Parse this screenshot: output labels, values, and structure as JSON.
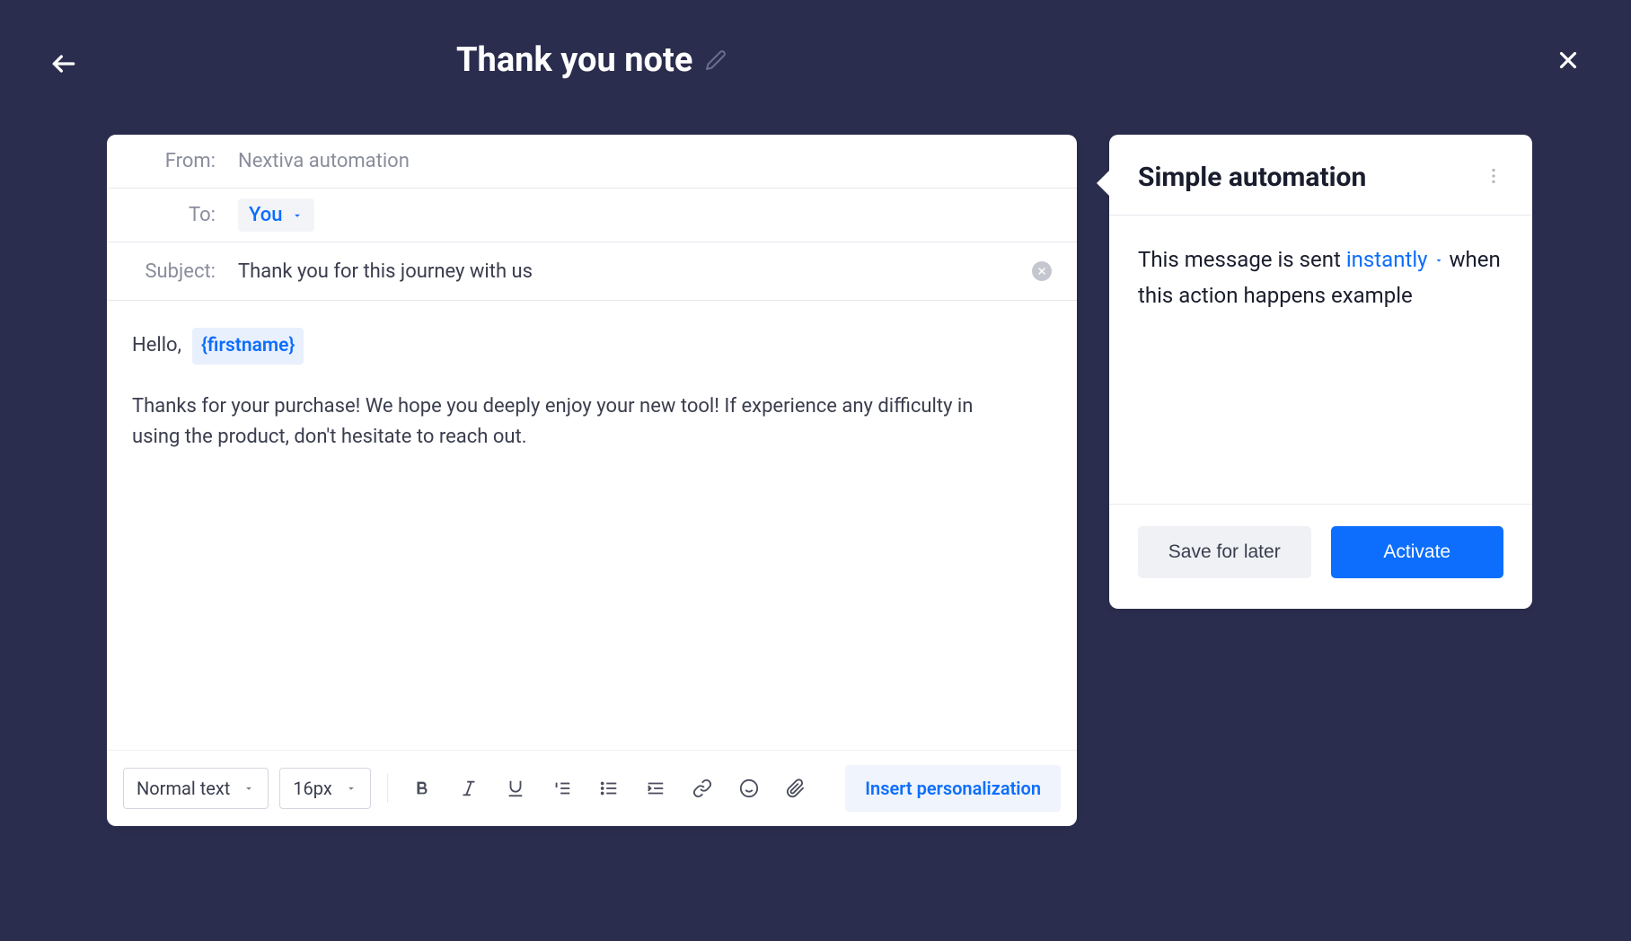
{
  "header": {
    "title": "Thank you note"
  },
  "composer": {
    "from_label": "From:",
    "from_value": "Nextiva automation",
    "to_label": "To:",
    "to_value": "You",
    "subject_label": "Subject:",
    "subject_value": "Thank you for this journey with us",
    "greeting": "Hello,",
    "merge_tag": "{firstname}",
    "body": "Thanks for your purchase! We hope you deeply enjoy your new tool! If experience any difficulty in using the product, don't hesitate to reach out."
  },
  "toolbar": {
    "text_style": "Normal text",
    "font_size": "16px",
    "insert_personalization": "Insert personalization"
  },
  "automation": {
    "title": "Simple automation",
    "desc_prefix": "This message is sent",
    "timing": "instantly",
    "desc_suffix": "when this action happens example",
    "save_label": "Save for later",
    "activate_label": "Activate"
  }
}
